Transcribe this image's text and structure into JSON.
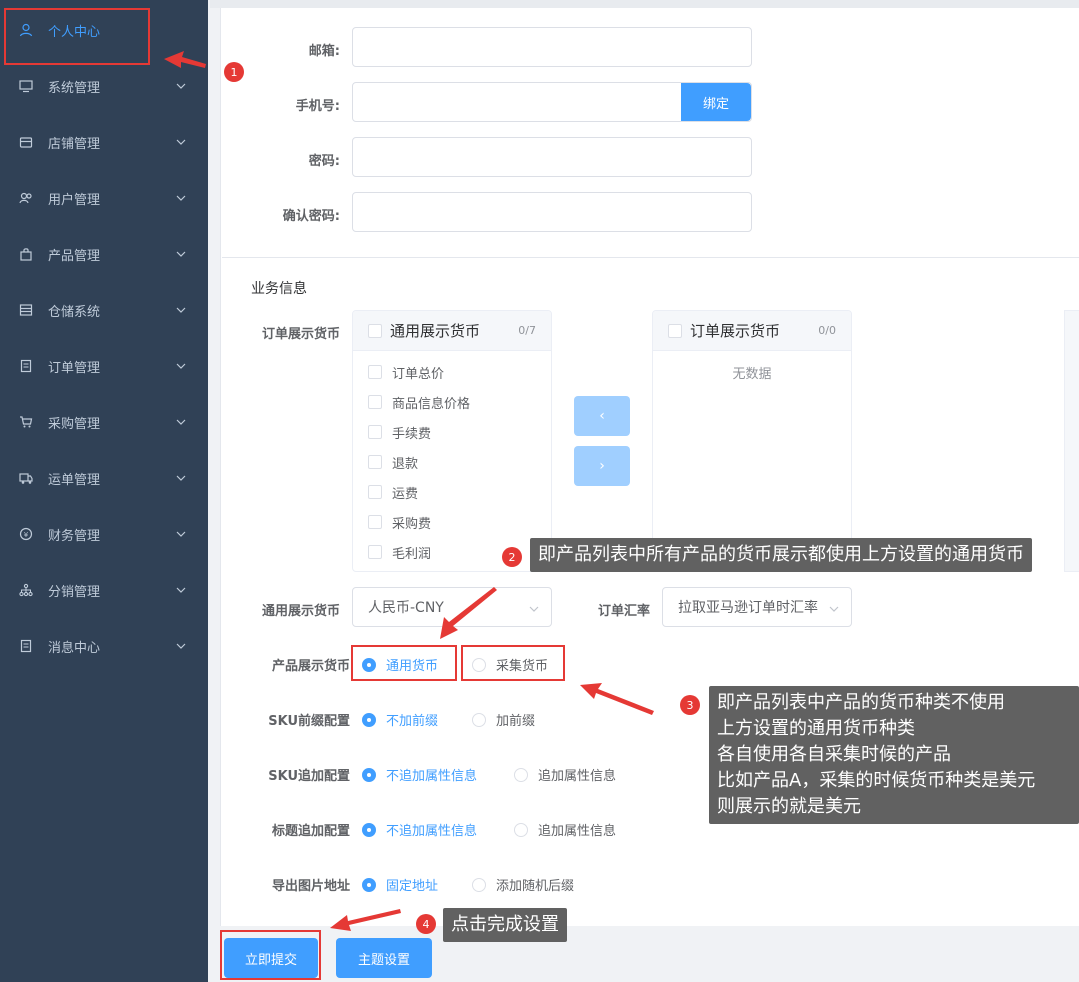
{
  "sidebar": {
    "items": [
      {
        "label": "个人中心",
        "icon": "user-icon",
        "active": true
      },
      {
        "label": "系统管理",
        "icon": "monitor-icon"
      },
      {
        "label": "店铺管理",
        "icon": "shop-icon"
      },
      {
        "label": "用户管理",
        "icon": "users-icon"
      },
      {
        "label": "产品管理",
        "icon": "bag-icon"
      },
      {
        "label": "仓储系统",
        "icon": "warehouse-icon"
      },
      {
        "label": "订单管理",
        "icon": "document-icon"
      },
      {
        "label": "采购管理",
        "icon": "cart-icon"
      },
      {
        "label": "运单管理",
        "icon": "truck-icon"
      },
      {
        "label": "财务管理",
        "icon": "coin-icon"
      },
      {
        "label": "分销管理",
        "icon": "network-icon"
      },
      {
        "label": "消息中心",
        "icon": "message-icon"
      }
    ]
  },
  "account": {
    "email_label": "邮箱:",
    "phone_label": "手机号:",
    "bind_button": "绑定",
    "password_label": "密码:",
    "confirm_password_label": "确认密码:"
  },
  "business": {
    "section_title": "业务信息",
    "order_currency_label": "订单展示货币",
    "left_panel": {
      "title": "通用展示货币",
      "count": "0/7",
      "items": [
        "订单总价",
        "商品信息价格",
        "手续费",
        "退款",
        "运费",
        "采购费",
        "毛利润"
      ]
    },
    "right_panel": {
      "title": "订单展示货币",
      "count": "0/0",
      "empty": "无数据"
    },
    "btn_left": "‹",
    "btn_right": "›",
    "general_currency_label": "通用展示货币",
    "general_currency_value": "人民币-CNY",
    "exchange_rate_label": "订单汇率",
    "exchange_rate_value": "拉取亚马逊订单时汇率",
    "product_currency_label": "产品展示货币",
    "product_currency_options": [
      "通用货币",
      "采集货币"
    ],
    "sku_prefix_label": "SKU前缀配置",
    "sku_prefix_options": [
      "不加前缀",
      "加前缀"
    ],
    "sku_append_label": "SKU追加配置",
    "sku_append_options": [
      "不追加属性信息",
      "追加属性信息"
    ],
    "title_append_label": "标题追加配置",
    "title_append_options": [
      "不追加属性信息",
      "追加属性信息"
    ],
    "export_image_label": "导出图片地址",
    "export_image_options": [
      "固定地址",
      "添加随机后缀"
    ]
  },
  "actions": {
    "submit": "立即提交",
    "theme": "主题设置"
  },
  "annotations": {
    "badge1": "1",
    "badge2": "2",
    "badge3": "3",
    "badge4": "4",
    "tip2": "即产品列表中所有产品的货币展示都使用上方设置的通用货币",
    "tip3": [
      "即产品列表中产品的货币种类不使用",
      "上方设置的通用货币种类",
      "各自使用各自采集时候的产品",
      "比如产品A，采集的时候货币种类是美元",
      "则展示的就是美元"
    ],
    "tip4": "点击完成设置",
    "color": "#e53935"
  },
  "colors": {
    "sidebar_bg": "#304156",
    "accent": "#409eff",
    "annotation_red": "#e53935"
  }
}
